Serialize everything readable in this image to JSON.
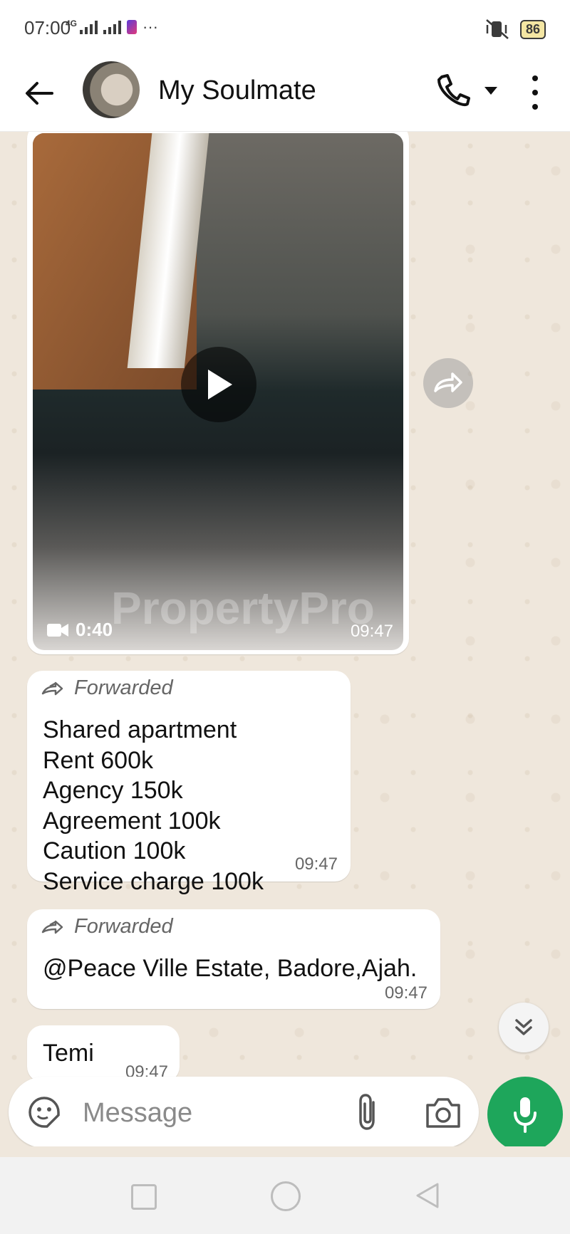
{
  "status_bar": {
    "time": "07:00",
    "network": "4G",
    "extra": "···",
    "battery": "86"
  },
  "header": {
    "contact_name": "My Soulmate"
  },
  "messages": {
    "video": {
      "duration": "0:40",
      "time": "09:47",
      "watermark": "PropertyPro"
    },
    "forwarded_label": "Forwarded",
    "msg1": {
      "text": "Shared apartment\nRent 600k\nAgency 150k\nAgreement 100k\nCaution 100k\nService charge 100k",
      "time": "09:47"
    },
    "msg2": {
      "text": "@Peace Ville  Estate, Badore,Ajah.",
      "time": "09:47"
    },
    "msg3": {
      "text": "Temi",
      "time": "09:47"
    }
  },
  "composer": {
    "placeholder": "Message"
  },
  "colors": {
    "accent": "#1ea65b",
    "chat_background": "#efe7dc",
    "bubble": "#ffffff"
  },
  "icons": [
    "back-arrow-icon",
    "phone-icon",
    "chevron-down-icon",
    "more-vertical-icon",
    "play-icon",
    "video-camera-icon",
    "share-forward-icon",
    "forward-icon",
    "double-chevron-down-icon",
    "sticker-icon",
    "paperclip-icon",
    "camera-icon",
    "microphone-icon",
    "recent-apps-icon",
    "home-icon",
    "back-nav-icon"
  ]
}
